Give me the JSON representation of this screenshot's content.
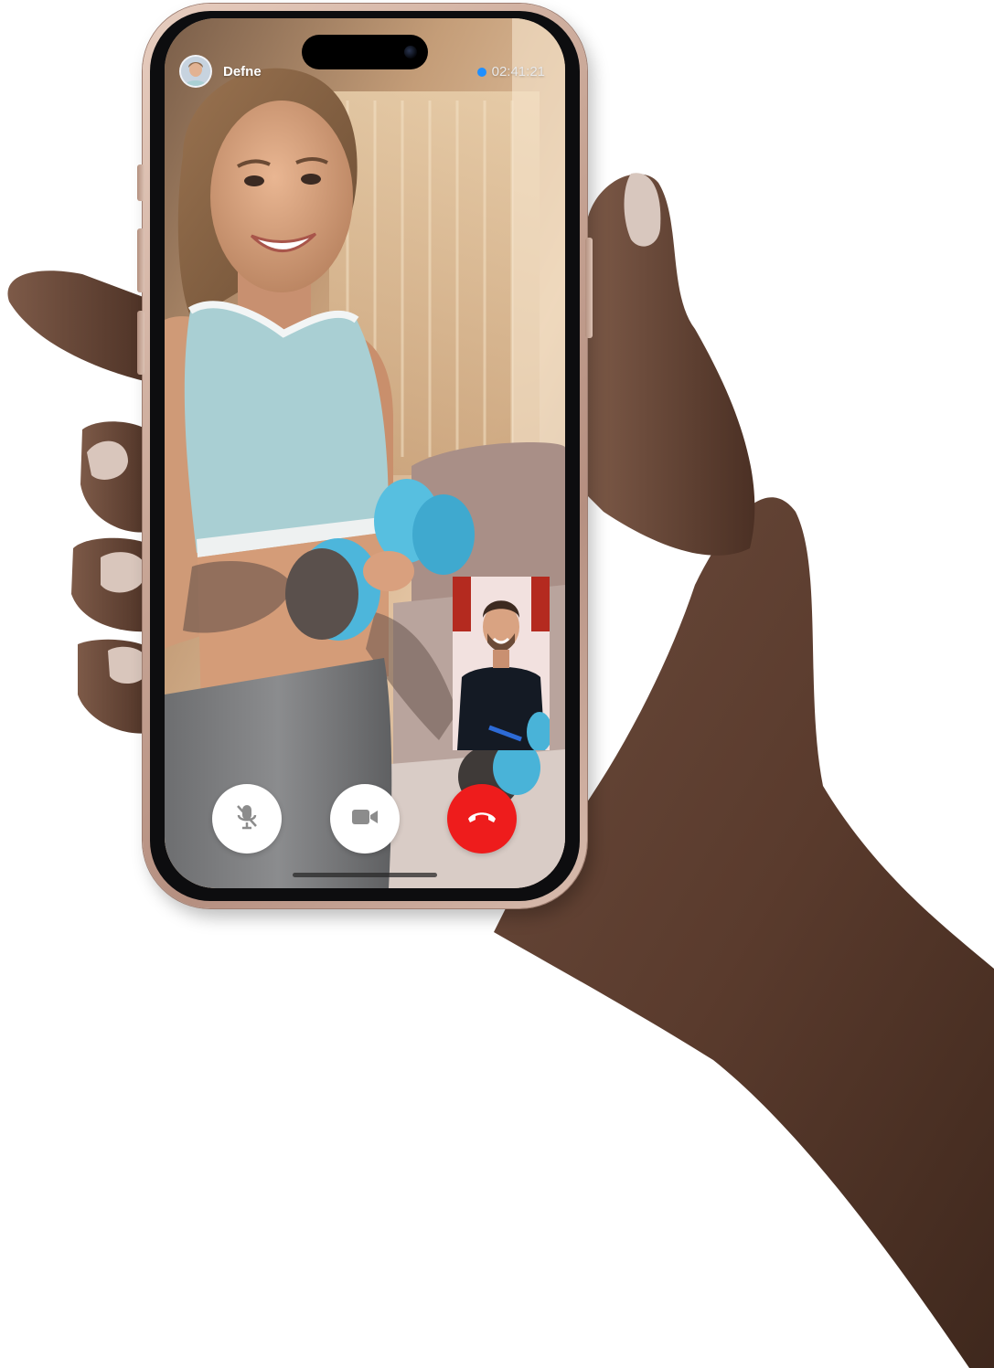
{
  "call": {
    "caller_name": "Defne",
    "timer": "02:41:21",
    "status_color": "#1f8fff"
  },
  "controls": {
    "mute_icon": "mic-off-icon",
    "video_icon": "video-camera-icon",
    "end_icon": "phone-hangup-icon",
    "end_color": "#ee1c1c"
  }
}
